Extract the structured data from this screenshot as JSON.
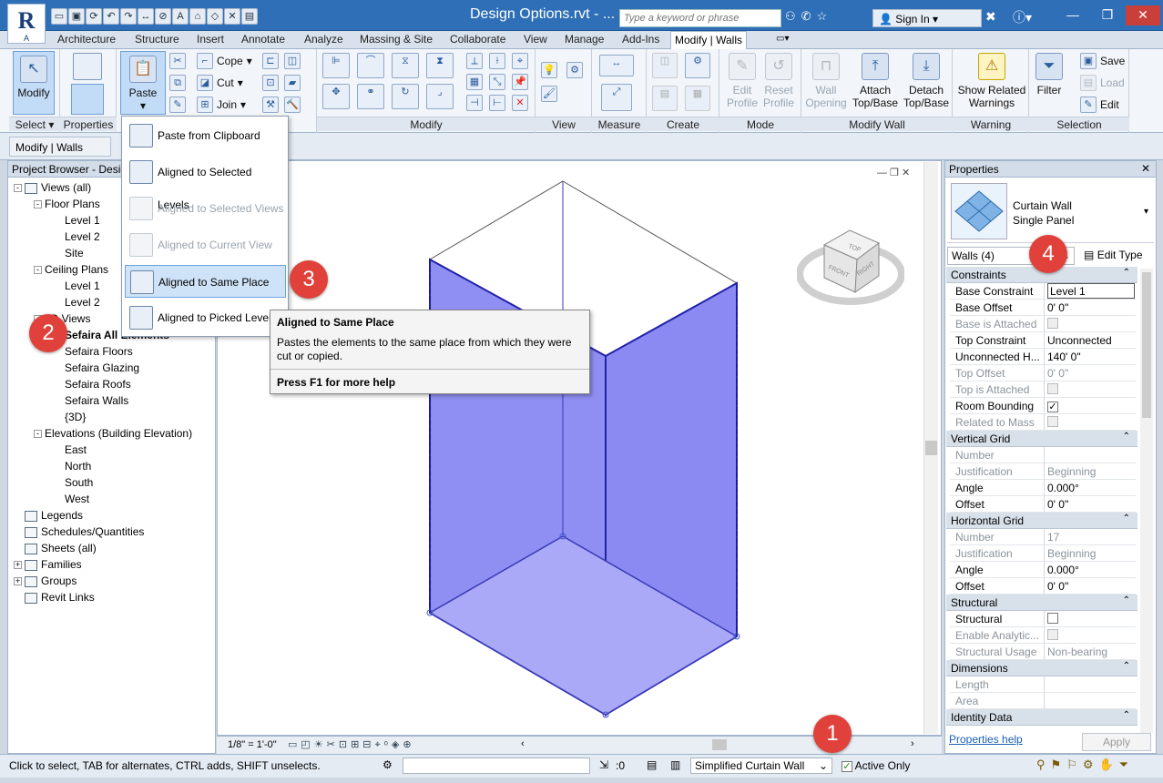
{
  "app": {
    "logo_letter": "R",
    "logo_sub": "A",
    "title": "Design Options.rvt - ..."
  },
  "quick_access": {
    "icons": [
      "open-icon",
      "save-icon",
      "sync-icon",
      "undo-icon",
      "redo-icon",
      "measure-icon",
      "tag-icon",
      "text-icon",
      "3d-icon",
      "section-icon",
      "close-views-icon",
      "switch-windows-icon"
    ]
  },
  "search": {
    "placeholder": "Type a keyword or phrase"
  },
  "signin": {
    "label": "Sign In"
  },
  "tabs": [
    "Architecture",
    "Structure",
    "Insert",
    "Annotate",
    "Analyze",
    "Massing & Site",
    "Collaborate",
    "View",
    "Manage",
    "Add-Ins",
    "Modify | Walls"
  ],
  "ribbon": {
    "select": {
      "modify": "Modify",
      "title": "Select"
    },
    "properties": {
      "title": "Properties"
    },
    "clipboard": {
      "paste": "Paste",
      "cope": "Cope",
      "cut": "Cut",
      "join": "Join"
    },
    "modify_title": "Modify",
    "view_title": "View",
    "measure_title": "Measure",
    "create_title": "Create",
    "mode": {
      "edit_profile": "Edit Profile",
      "reset_profile": "Reset Profile",
      "title": "Mode"
    },
    "modify_wall": {
      "wall_opening": "Wall Opening",
      "attach": "Attach Top/Base",
      "detach": "Detach Top/Base",
      "title": "Modify Wall"
    },
    "warning": {
      "show": "Show Related Warnings",
      "title": "Warning"
    },
    "selection": {
      "filter": "Filter",
      "save": "Save",
      "load": "Load",
      "edit": "Edit",
      "title": "Selection"
    }
  },
  "options_bar": {
    "context": "Modify | Walls"
  },
  "project_browser": {
    "title": "Project Browser - Design Options.rvt",
    "items": [
      {
        "label": "Views (all)",
        "level": 0,
        "exp": "-"
      },
      {
        "label": "Floor Plans",
        "level": 1,
        "exp": "-"
      },
      {
        "label": "Level 1",
        "level": 2
      },
      {
        "label": "Level 2",
        "level": 2
      },
      {
        "label": "Site",
        "level": 2
      },
      {
        "label": "Ceiling Plans",
        "level": 1,
        "exp": "-"
      },
      {
        "label": "Level 1",
        "level": 2
      },
      {
        "label": "Level 2",
        "level": 2
      },
      {
        "label": "3D Views",
        "level": 1,
        "exp": "-"
      },
      {
        "label": "Sefaira All Elements",
        "level": 2,
        "bold": true
      },
      {
        "label": "Sefaira Floors",
        "level": 2
      },
      {
        "label": "Sefaira Glazing",
        "level": 2
      },
      {
        "label": "Sefaira Roofs",
        "level": 2
      },
      {
        "label": "Sefaira Walls",
        "level": 2
      },
      {
        "label": "{3D}",
        "level": 2
      },
      {
        "label": "Elevations (Building Elevation)",
        "level": 1,
        "exp": "-"
      },
      {
        "label": "East",
        "level": 2
      },
      {
        "label": "North",
        "level": 2
      },
      {
        "label": "South",
        "level": 2
      },
      {
        "label": "West",
        "level": 2
      },
      {
        "label": "Legends",
        "level": 0,
        "icon": true
      },
      {
        "label": "Schedules/Quantities",
        "level": 0,
        "icon": true
      },
      {
        "label": "Sheets (all)",
        "level": 0,
        "icon": true
      },
      {
        "label": "Families",
        "level": 0,
        "icon": true,
        "exp": "+"
      },
      {
        "label": "Groups",
        "level": 0,
        "icon": true,
        "exp": "+"
      },
      {
        "label": "Revit Links",
        "level": 0,
        "icon": true
      }
    ]
  },
  "paste_menu": {
    "items": [
      {
        "label": "Paste from Clipboard",
        "state": "enabled"
      },
      {
        "label": "Aligned to Selected Levels",
        "state": "enabled"
      },
      {
        "label": "Aligned to Selected Views",
        "state": "disabled"
      },
      {
        "label": "Aligned to Current View",
        "state": "disabled"
      },
      {
        "label": "Aligned to Same Place",
        "state": "highlighted"
      },
      {
        "label": "Aligned to Picked Level",
        "state": "enabled"
      }
    ]
  },
  "tooltip": {
    "title": "Aligned to Same Place",
    "body": "Pastes the elements to the same place from which they were cut or copied.",
    "help": "Press F1 for more help"
  },
  "viewcube": {
    "top": "TOP",
    "front": "FRONT",
    "right": "RIGHT"
  },
  "view_bar": {
    "scale": "1/8\" = 1'-0\""
  },
  "properties": {
    "title": "Properties",
    "type_name": "Curtain Wall",
    "type_sub": "Single Panel",
    "filter": "Walls (4)",
    "edit_type": "Edit Type",
    "groups": [
      {
        "name": "Constraints",
        "rows": [
          {
            "k": "Base Constraint",
            "v": "Level 1"
          },
          {
            "k": "Base Offset",
            "v": "0'  0\""
          },
          {
            "k": "Base is Attached",
            "v": "",
            "dis": true,
            "cb": "off"
          },
          {
            "k": "Top Constraint",
            "v": "Unconnected"
          },
          {
            "k": "Unconnected H...",
            "v": "140'  0\""
          },
          {
            "k": "Top Offset",
            "v": "0'  0\"",
            "dis": true
          },
          {
            "k": "Top is Attached",
            "v": "",
            "dis": true,
            "cb": "off"
          },
          {
            "k": "Room Bounding",
            "v": "",
            "cb": "on"
          },
          {
            "k": "Related to Mass",
            "v": "",
            "dis": true,
            "cb": "off"
          }
        ]
      },
      {
        "name": "Vertical Grid",
        "rows": [
          {
            "k": "Number",
            "v": "",
            "dis": true
          },
          {
            "k": "Justification",
            "v": "Beginning",
            "dis": true
          },
          {
            "k": "Angle",
            "v": "0.000°"
          },
          {
            "k": "Offset",
            "v": "0'  0\""
          }
        ]
      },
      {
        "name": "Horizontal Grid",
        "rows": [
          {
            "k": "Number",
            "v": "17",
            "dis": true
          },
          {
            "k": "Justification",
            "v": "Beginning",
            "dis": true
          },
          {
            "k": "Angle",
            "v": "0.000°"
          },
          {
            "k": "Offset",
            "v": "0'  0\""
          }
        ]
      },
      {
        "name": "Structural",
        "rows": [
          {
            "k": "Structural",
            "v": "",
            "cb": "empty"
          },
          {
            "k": "Enable Analytic...",
            "v": "",
            "dis": true,
            "cb": "off"
          },
          {
            "k": "Structural Usage",
            "v": "Non-bearing",
            "dis": true
          }
        ]
      },
      {
        "name": "Dimensions",
        "rows": [
          {
            "k": "Length",
            "v": "",
            "dis": true
          },
          {
            "k": "Area",
            "v": "",
            "dis": true
          }
        ]
      },
      {
        "name": "Identity Data",
        "rows": []
      }
    ],
    "help_link": "Properties help",
    "apply": "Apply"
  },
  "status": {
    "message": "Click to select, TAB for alternates, CTRL adds, SHIFT unselects.",
    "filter_count": ":0",
    "option": "Simplified Curtain Wall",
    "active_only": "Active Only"
  },
  "badges": [
    "1",
    "2",
    "3",
    "4"
  ],
  "colors": {
    "accent": "#2e6fb7",
    "selection_fill": "#7a7af0",
    "badge": "#e0413a"
  }
}
